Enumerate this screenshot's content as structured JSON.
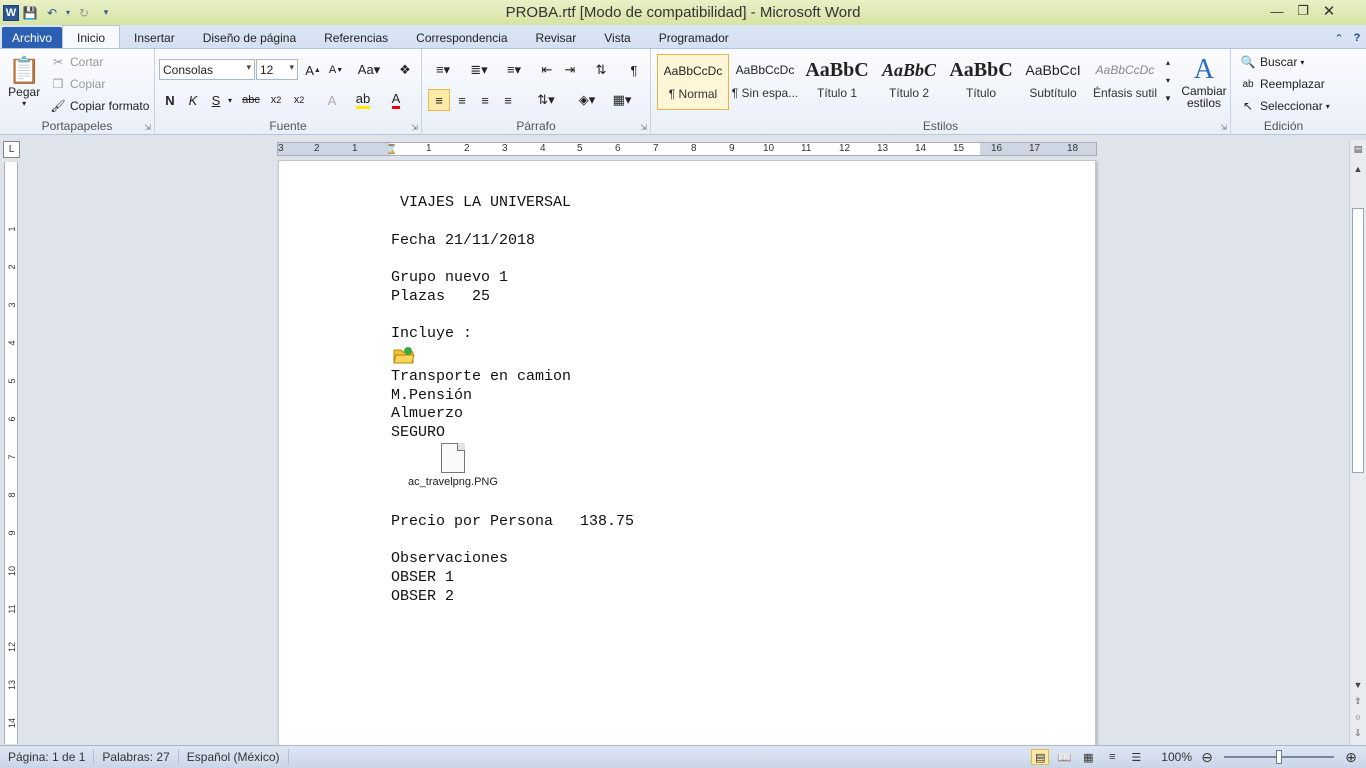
{
  "window": {
    "title": "PROBA.rtf [Modo de compatibilidad]  -  Microsoft Word",
    "app_icon": "W"
  },
  "tabs": [
    "Archivo",
    "Inicio",
    "Insertar",
    "Diseño de página",
    "Referencias",
    "Correspondencia",
    "Revisar",
    "Vista",
    "Programador"
  ],
  "active_tab": "Inicio",
  "ribbon": {
    "clipboard": {
      "label": "Portapapeles",
      "paste": "Pegar",
      "cut": "Cortar",
      "copy": "Copiar",
      "format_painter": "Copiar formato"
    },
    "font": {
      "label": "Fuente",
      "family": "Consolas",
      "size": "12"
    },
    "paragraph": {
      "label": "Párrafo"
    },
    "styles": {
      "label": "Estilos",
      "items": [
        {
          "sample": "AaBbCcDc",
          "name": "¶ Normal"
        },
        {
          "sample": "AaBbCcDc",
          "name": "¶ Sin espa..."
        },
        {
          "sample": "AaBbC",
          "name": "Título 1"
        },
        {
          "sample": "AaBbC",
          "name": "Título 2"
        },
        {
          "sample": "AaBbC",
          "name": "Título"
        },
        {
          "sample": "AaBbCcI",
          "name": "Subtítulo"
        },
        {
          "sample": "AaBbCcDc",
          "name": "Énfasis sutil"
        }
      ],
      "change_styles": "Cambiar estilos"
    },
    "editing": {
      "label": "Edición",
      "find": "Buscar",
      "replace": "Reemplazar",
      "select": "Seleccionar"
    }
  },
  "document": {
    "lines": [
      " VIAJES LA UNIVERSAL",
      "Fecha 21/11/2018",
      "Grupo nuevo 1",
      "Plazas   25",
      "Incluye :",
      "Transporte en camion",
      "M.Pensión",
      "Almuerzo",
      "SEGURO",
      "Precio por Persona   138.75",
      "Observaciones",
      "OBSER 1",
      "OBSER 2"
    ],
    "attachment_name": "ac_travelpng.PNG"
  },
  "ruler": {
    "ticks": [
      "3",
      "2",
      "1",
      "1",
      "2",
      "3",
      "4",
      "5",
      "6",
      "7",
      "8",
      "9",
      "10",
      "11",
      "12",
      "13",
      "14",
      "15",
      "16",
      "17",
      "18"
    ],
    "v_ticks": [
      "1",
      "2",
      "3",
      "4",
      "5",
      "6",
      "7",
      "8",
      "9",
      "10",
      "11",
      "12",
      "13",
      "14"
    ],
    "corner": "L"
  },
  "status": {
    "page": "Página: 1 de 1",
    "words": "Palabras: 27",
    "language": "Español (México)",
    "zoom": "100%"
  },
  "colors": {
    "accent": "#2b5fb3",
    "titlebar": "#d5e4a4",
    "selected": "#fde9a8"
  }
}
